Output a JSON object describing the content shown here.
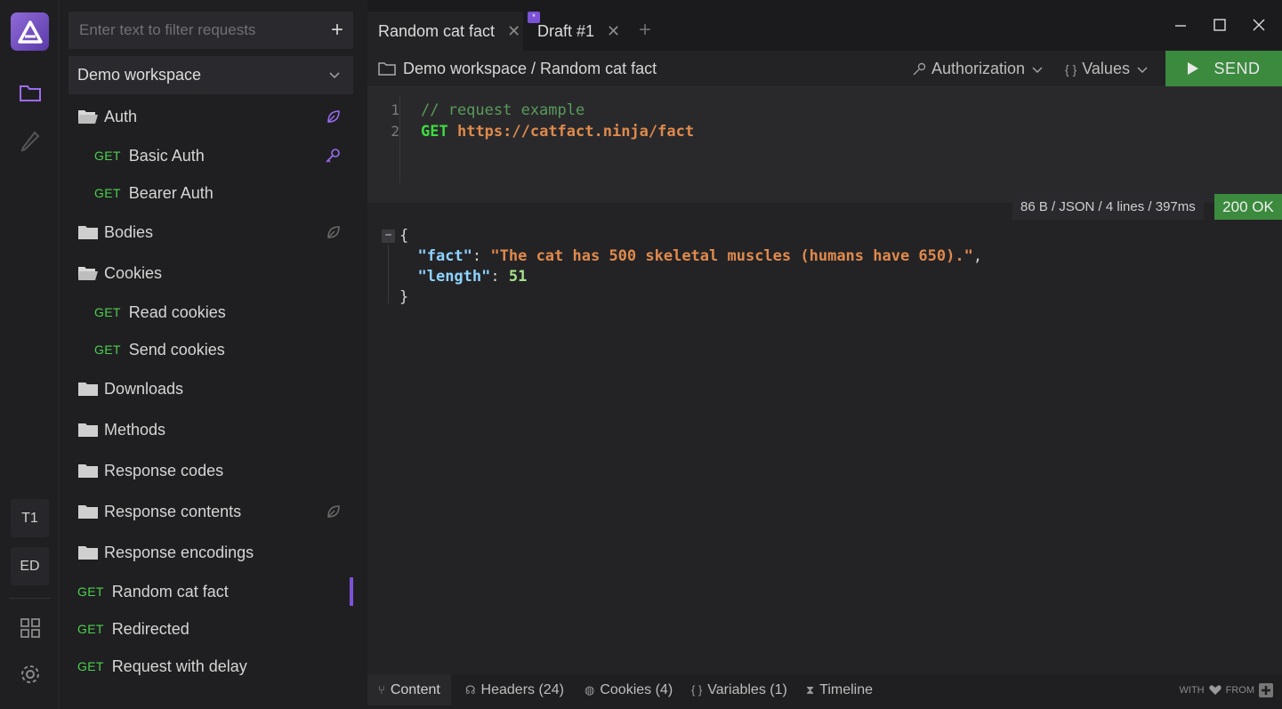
{
  "sidebar": {
    "filter_placeholder": "Enter text to filter requests",
    "add_label": "+",
    "workspace": "Demo workspace",
    "items": [
      {
        "kind": "folder",
        "label": "Auth",
        "open": true
      },
      {
        "kind": "request",
        "method": "GET",
        "label": "Basic Auth"
      },
      {
        "kind": "request",
        "method": "GET",
        "label": "Bearer Auth"
      },
      {
        "kind": "folder",
        "label": "Bodies"
      },
      {
        "kind": "folder",
        "label": "Cookies",
        "open": true
      },
      {
        "kind": "request",
        "method": "GET",
        "label": "Read cookies"
      },
      {
        "kind": "request",
        "method": "GET",
        "label": "Send cookies"
      },
      {
        "kind": "folder",
        "label": "Downloads"
      },
      {
        "kind": "folder",
        "label": "Methods"
      },
      {
        "kind": "folder",
        "label": "Response codes"
      },
      {
        "kind": "folder",
        "label": "Response contents"
      },
      {
        "kind": "folder",
        "label": "Response encodings"
      },
      {
        "kind": "request",
        "method": "GET",
        "label": "Random cat fact",
        "active": true
      },
      {
        "kind": "request",
        "method": "GET",
        "label": "Redirected"
      },
      {
        "kind": "request",
        "method": "GET",
        "label": "Request with delay"
      }
    ]
  },
  "activity": {
    "badges": [
      "T1",
      "ED"
    ]
  },
  "tabs": [
    {
      "label": "Random cat fact",
      "active": true,
      "close": "✕"
    },
    {
      "label": "Draft #1",
      "active": false,
      "close": "✕",
      "star": "*"
    }
  ],
  "tab_add": "+",
  "request": {
    "breadcrumb": "Demo workspace / Random cat fact",
    "authorization": "Authorization",
    "values_label": "Values",
    "values_lead": "{ }",
    "send_label": "SEND",
    "gutter": [
      "1",
      "2"
    ],
    "comment": "// request example",
    "method": "GET",
    "url": "https://catfact.ninja/fact"
  },
  "response": {
    "meta": "86 B / JSON / 4 lines / 397ms",
    "status": "200 OK",
    "fold": "−",
    "open_brace": "{",
    "close_brace": "}",
    "fact_key": "\"fact\"",
    "fact_value": "\"The cat has 500 skeletal muscles (humans have 650).\"",
    "length_key": "\"length\"",
    "length_value": "51"
  },
  "bottom_tabs": [
    {
      "label": "Content",
      "icon": "content-icon",
      "glyph": "⑂"
    },
    {
      "label": "Headers (24)",
      "icon": "headphones-icon",
      "glyph": "☊"
    },
    {
      "label": "Cookies (4)",
      "icon": "cookie-icon",
      "glyph": "◍"
    },
    {
      "label": "Variables (1)",
      "icon": "braces-icon",
      "glyph": "{ }"
    },
    {
      "label": "Timeline",
      "icon": "hourglass-icon",
      "glyph": "⧗"
    }
  ],
  "credit": {
    "with": "WITH",
    "from": "FROM"
  },
  "colors": {
    "accent": "#7b52d6",
    "success": "#3b8a3e",
    "method_get": "#4dd04d"
  }
}
